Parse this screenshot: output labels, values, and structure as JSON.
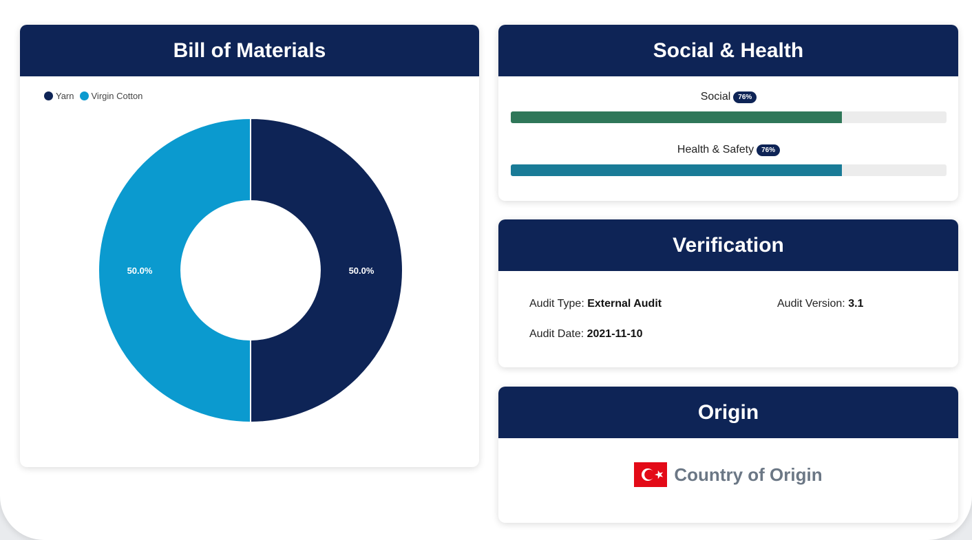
{
  "bom": {
    "title": "Bill of Materials",
    "legend": [
      {
        "label": "Yarn",
        "color": "#0e2456"
      },
      {
        "label": "Virgin Cotton",
        "color": "#0b9acf"
      }
    ]
  },
  "chart_data": {
    "type": "pie",
    "donut": true,
    "categories": [
      "Yarn",
      "Virgin Cotton"
    ],
    "values": [
      50.0,
      50.0
    ],
    "labels": [
      "50.0%",
      "50.0%"
    ],
    "colors": [
      "#0e2456",
      "#0b9acf"
    ],
    "legend_position": "top-left"
  },
  "social": {
    "title": "Social & Health",
    "bars": [
      {
        "label": "Social",
        "badge": "76%",
        "value": 0.76,
        "color": "#2f7759"
      },
      {
        "label": "Health & Safety",
        "badge": "76%",
        "value": 0.76,
        "color": "#197b97"
      }
    ]
  },
  "verification": {
    "title": "Verification",
    "audit_type_label": "Audit Type:",
    "audit_type_value": "External Audit",
    "audit_version_label": "Audit Version:",
    "audit_version_value": "3.1",
    "audit_date_label": "Audit Date:",
    "audit_date_value": "2021-11-10"
  },
  "origin": {
    "title": "Origin",
    "label": "Country of Origin",
    "flag_icon": "turkey-flag-icon"
  }
}
